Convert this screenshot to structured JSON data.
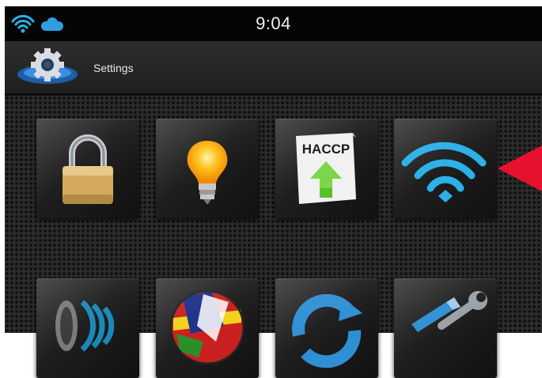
{
  "status_bar": {
    "time": "9:04",
    "icons": [
      "wifi-icon",
      "cloud-icon"
    ]
  },
  "header": {
    "title": "Settings",
    "icon": "settings-gear-icon"
  },
  "tiles": [
    {
      "icon": "lock-icon",
      "row": 1,
      "column": 1
    },
    {
      "icon": "light-bulb-icon",
      "row": 1,
      "column": 2
    },
    {
      "icon": "haccp-upload-icon",
      "label": "HACCP",
      "row": 1,
      "column": 3
    },
    {
      "icon": "wifi-icon",
      "row": 1,
      "column": 4
    },
    {
      "icon": "sound-icon",
      "row": 2,
      "column": 1
    },
    {
      "icon": "globe-flags-icon",
      "row": 2,
      "column": 2
    },
    {
      "icon": "refresh-icon",
      "row": 2,
      "column": 3
    },
    {
      "icon": "tools-icon",
      "row": 2,
      "column": 4
    }
  ],
  "pointer": {
    "icon": "red-arrow-icon",
    "color": "#e8112d"
  },
  "colors": {
    "wifi_blue": "#2bb0e8",
    "cloud_blue": "#2f9ee0",
    "bulb_orange": "#ffb400",
    "arrow_green": "#5bbf2a",
    "lock_gold": "#d4a960"
  }
}
